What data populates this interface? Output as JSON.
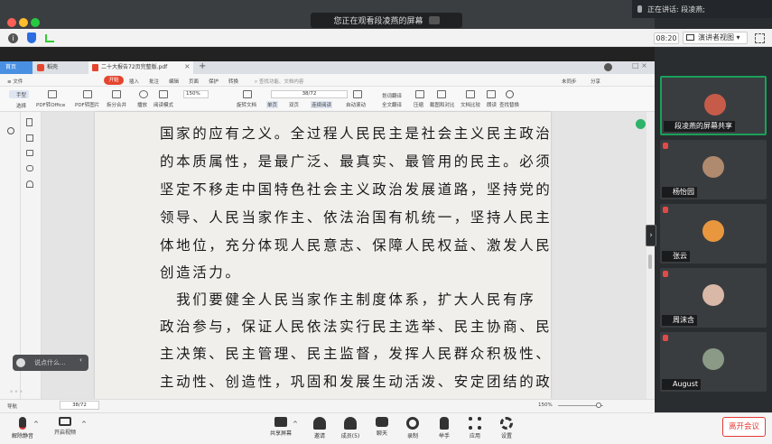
{
  "banner": {
    "text": "您正在观看段凌燕的屏幕"
  },
  "speaking": {
    "text": "正在讲话: 段凌燕;"
  },
  "toolbar": {
    "time": "08:20",
    "view_mode": "演讲者视图"
  },
  "wps": {
    "tabs": [
      "首页",
      "稻壳",
      "二十大报告72页完整版.pdf"
    ],
    "menu": [
      "文件",
      "开始",
      "插入",
      "批注",
      "编辑",
      "页面",
      "保护",
      "转换"
    ],
    "search_placeholder": "查找功能、文档内容",
    "sync": "未同步",
    "share": "分享",
    "ribbon": [
      "手型",
      "选择",
      "PDF转Office",
      "PDF转图片",
      "拆分合并",
      "播放",
      "阅读模式",
      "旋转文档",
      "单页",
      "双页",
      "连续阅读",
      "自动滚动",
      "划词翻译",
      "全文翻译",
      "压缩",
      "截图和对比",
      "文档比较",
      "朗读",
      "查找替换"
    ],
    "zoom": "150%",
    "page_indicator": "38/72",
    "status_left": "导航",
    "status_page": "38/72",
    "status_zoom": "150%"
  },
  "document": {
    "lines": [
      "国家的应有之义。全过程人民民主是社会主义民主政治",
      "的本质属性，是最广泛、最真实、最管用的民主。必须",
      "坚定不移走中国特色社会主义政治发展道路，坚持党的",
      "领导、人民当家作主、依法治国有机统一，坚持人民主",
      "体地位，充分体现人民意志、保障人民权益、激发人民",
      "创造活力。",
      "　我们要健全人民当家作主制度体系，扩大人民有序",
      "政治参与，保证人民依法实行民主选举、民主协商、民",
      "主决策、民主管理、民主监督，发挥人民群众积极性、",
      "主动性、创造性，巩固和发展生动活泼、安定团结的政"
    ]
  },
  "voice_input": {
    "placeholder": "说点什么..."
  },
  "participants": [
    {
      "name": "段凌燕的屏幕共享",
      "color": "#c75b4a"
    },
    {
      "name": "杨怡园",
      "color": "#b08a6e"
    },
    {
      "name": "张云",
      "color": "#e8973f"
    },
    {
      "name": "周沫含",
      "color": "#d9b8a8"
    },
    {
      "name": "August",
      "color": "#8a9a86"
    }
  ],
  "bottom": {
    "mute": "解除静音",
    "video": "开启视频",
    "share": "共享屏幕",
    "invite": "邀请",
    "members": "成员(5)",
    "chat": "聊天",
    "record": "录制",
    "raise": "举手",
    "apps": "应用",
    "settings": "设置",
    "leave": "离开会议"
  },
  "colors": {
    "accent": "#1aa05a",
    "danger": "#e53935",
    "wps_red": "#e5452f"
  }
}
